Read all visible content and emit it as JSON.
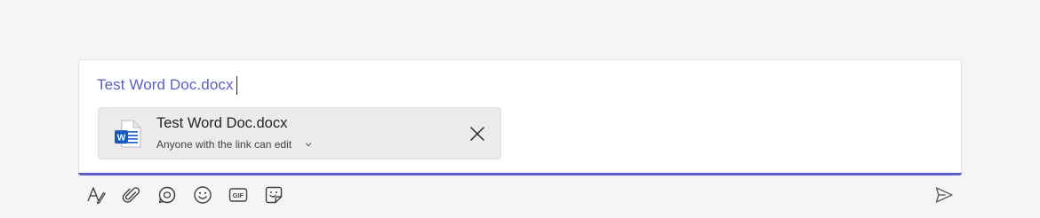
{
  "compose": {
    "message_text": "Test Word Doc.docx",
    "accent_color": "#5b5fc7"
  },
  "attachment": {
    "file_name": "Test Word Doc.docx",
    "permission": "Anyone with the link can edit",
    "file_icon": "word-document-icon",
    "file_icon_letter": "W",
    "close_icon": "close-icon",
    "chevron_icon": "chevron-down-icon"
  },
  "toolbar": {
    "buttons": [
      {
        "name": "format",
        "icon": "format-text-icon"
      },
      {
        "name": "attach",
        "icon": "paperclip-icon"
      },
      {
        "name": "loop",
        "icon": "loop-component-icon"
      },
      {
        "name": "emoji",
        "icon": "emoji-icon"
      },
      {
        "name": "gif",
        "icon": "gif-icon",
        "label": "GIF"
      },
      {
        "name": "sticker",
        "icon": "sticker-icon"
      }
    ],
    "send": {
      "icon": "send-icon"
    }
  }
}
